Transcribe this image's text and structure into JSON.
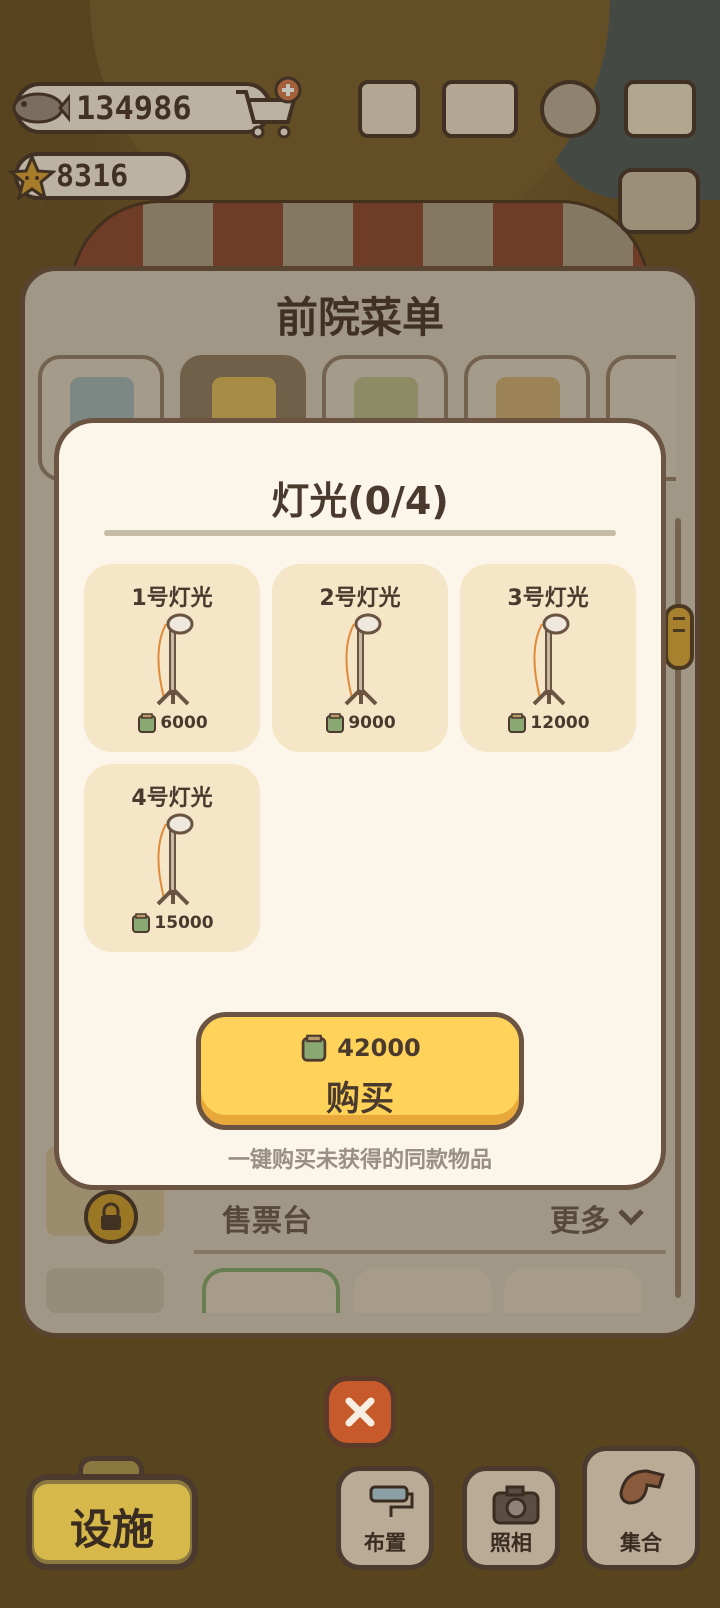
{
  "hud": {
    "fish_count": "134986",
    "star_count": "8316"
  },
  "panel": {
    "title": "前院菜单",
    "section_label": "售票台",
    "more_label": "更多"
  },
  "dialog": {
    "title": "灯光(0/4)",
    "items": [
      {
        "name": "1号灯光",
        "price": "6000"
      },
      {
        "name": "2号灯光",
        "price": "9000"
      },
      {
        "name": "3号灯光",
        "price": "12000"
      },
      {
        "name": "4号灯光",
        "price": "15000"
      }
    ],
    "buy_price": "42000",
    "buy_label": "购买",
    "buy_hint": "一键购买未获得的同款物品"
  },
  "bottom_bar": {
    "facility_label": "设施",
    "arrange_label": "布置",
    "photo_label": "照相",
    "gather_label": "集合"
  },
  "icons": {
    "fish": "fish-icon",
    "star": "star-icon",
    "cart": "cart-plus-icon",
    "newspaper": "newspaper-icon",
    "book": "book-icon",
    "gear": "gear-icon",
    "map": "map-icon",
    "sort": "sort-icon",
    "lamp": "lamp-icon",
    "can": "can-icon",
    "lock": "lock-icon",
    "close": "close-icon",
    "camera": "camera-icon",
    "whistle": "whistle-icon"
  },
  "colors": {
    "buy_button": "#ffd35a",
    "close_button": "#c65a2a",
    "item_card": "#f4e6c7"
  }
}
